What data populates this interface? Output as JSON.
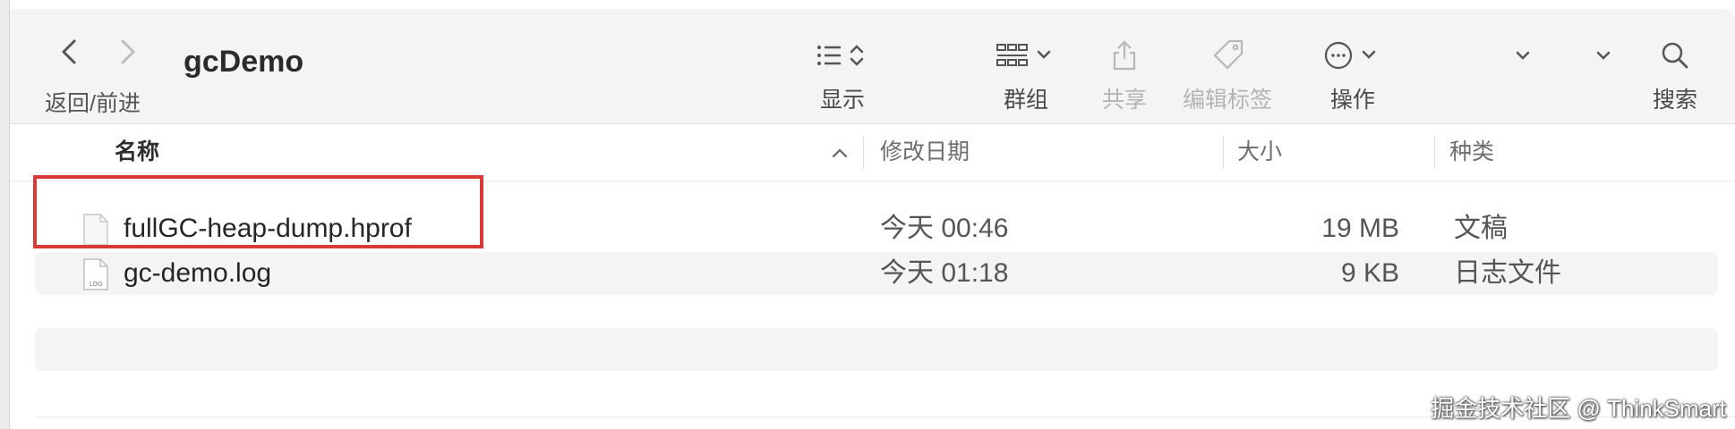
{
  "window": {
    "title": "gcDemo",
    "nav_label": "返回/前进"
  },
  "toolbar": {
    "view_label": "显示",
    "group_label": "群组",
    "share_label": "共享",
    "tags_label": "编辑标签",
    "action_label": "操作",
    "search_label": "搜索"
  },
  "columns": {
    "name": "名称",
    "date_modified": "修改日期",
    "size": "大小",
    "kind": "种类"
  },
  "files": [
    {
      "name": "fullGC-heap-dump.hprof",
      "modified": "今天 00:46",
      "size": "19 MB",
      "kind": "文稿",
      "icon": "document-icon",
      "icon_tag": ""
    },
    {
      "name": "gc-demo.log",
      "modified": "今天 01:18",
      "size": "9 KB",
      "kind": "日志文件",
      "icon": "log-file-icon",
      "icon_tag": "LOG"
    }
  ],
  "watermark": "掘金技术社区 @ ThinkSmart",
  "colors": {
    "highlight_border": "#d93a36",
    "toolbar_bg": "#f5f3f3",
    "alt_row_bg": "#f4f4f4"
  }
}
